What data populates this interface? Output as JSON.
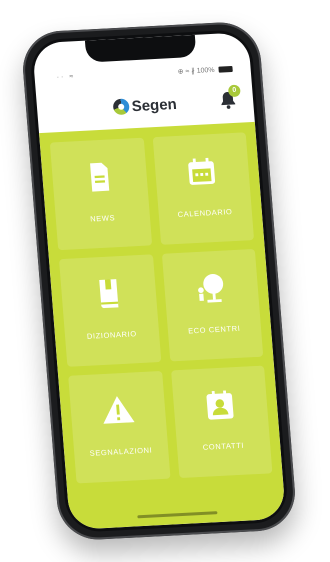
{
  "status": {
    "left": "··  ≈",
    "right": "⊕ ≈ ∦ 100%"
  },
  "appbar": {
    "logo_text": "Segen",
    "notification_count": "0"
  },
  "tiles": [
    {
      "label": "NEWS",
      "icon": "news-icon"
    },
    {
      "label": "CALENDARIO",
      "icon": "calendar-icon"
    },
    {
      "label": "DIZIONARIO",
      "icon": "book-icon"
    },
    {
      "label": "ECO CENTRI",
      "icon": "eco-center-icon"
    },
    {
      "label": "SEGNALAZIONI",
      "icon": "warning-icon"
    },
    {
      "label": "CONTATTI",
      "icon": "contact-icon"
    }
  ],
  "colors": {
    "accent": "#c8dc3a",
    "phone_frame": "#1b1c1e"
  }
}
